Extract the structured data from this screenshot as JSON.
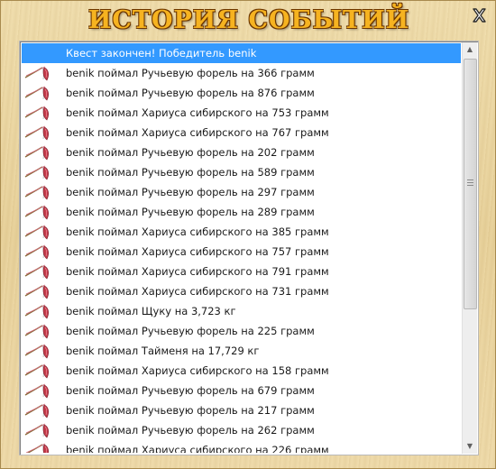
{
  "window": {
    "title": "ИСТОРИЯ СОБЫТИЙ",
    "close_icon": "close-x-icon"
  },
  "events": [
    {
      "text": "Квест закончен! Победитель benik",
      "icon": "none",
      "selected": true
    },
    {
      "text": "benik поймал Ручьевую форель на 366 грамм",
      "icon": "fishing-rod-icon"
    },
    {
      "text": "benik поймал Ручьевую форель на 876 грамм",
      "icon": "fishing-rod-icon"
    },
    {
      "text": "benik поймал Хариуса сибирского на 753 грамм",
      "icon": "fishing-rod-icon"
    },
    {
      "text": "benik поймал Хариуса сибирского на 767 грамм",
      "icon": "fishing-rod-icon"
    },
    {
      "text": "benik поймал Ручьевую форель на 202 грамм",
      "icon": "fishing-rod-icon"
    },
    {
      "text": "benik поймал Ручьевую форель на 589 грамм",
      "icon": "fishing-rod-icon"
    },
    {
      "text": "benik поймал Ручьевую форель на 297 грамм",
      "icon": "fishing-rod-icon"
    },
    {
      "text": "benik поймал Ручьевую форель на 289 грамм",
      "icon": "fishing-rod-icon"
    },
    {
      "text": "benik поймал Хариуса сибирского на 385 грамм",
      "icon": "fishing-rod-icon"
    },
    {
      "text": "benik поймал Хариуса сибирского на 757 грамм",
      "icon": "fishing-rod-icon"
    },
    {
      "text": "benik поймал Хариуса сибирского на 791 грамм",
      "icon": "fishing-rod-icon"
    },
    {
      "text": "benik поймал Хариуса сибирского на 731 грамм",
      "icon": "fishing-rod-icon"
    },
    {
      "text": "benik поймал Щуку на 3,723 кг",
      "icon": "fishing-rod-icon"
    },
    {
      "text": "benik поймал Ручьевую форель на 225 грамм",
      "icon": "fishing-rod-icon"
    },
    {
      "text": "benik поймал Тайменя на 17,729 кг",
      "icon": "fishing-rod-icon"
    },
    {
      "text": "benik поймал Хариуса сибирского на 158 грамм",
      "icon": "fishing-rod-icon"
    },
    {
      "text": "benik поймал Ручьевую форель на 679 грамм",
      "icon": "fishing-rod-icon"
    },
    {
      "text": "benik поймал Ручьевую форель на 217 грамм",
      "icon": "fishing-rod-icon"
    },
    {
      "text": "benik поймал Ручьевую форель на 262 грамм",
      "icon": "fishing-rod-icon"
    },
    {
      "text": "benik поймал Хариуса сибирского на 226 грамм",
      "icon": "fishing-rod-icon"
    }
  ],
  "colors": {
    "selection": "#3399ff",
    "title_gold": "#f6b320",
    "title_outline": "#6b3500",
    "wood": "#e9d6a6"
  }
}
